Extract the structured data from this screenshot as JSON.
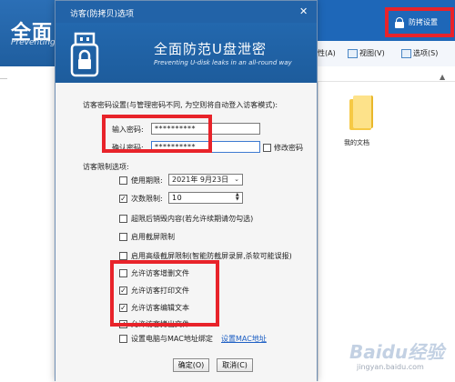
{
  "background_app": {
    "title": "全面",
    "subtitle": "Preventing",
    "protect_button": "防拷设置",
    "toolbar": [
      {
        "label": "性(A)"
      },
      {
        "label": "视图(V)"
      },
      {
        "label": "选项(S)"
      }
    ],
    "folder_label": "我的文档"
  },
  "dialog": {
    "title": "访客(防拷贝)选项",
    "close": "✕",
    "banner_title": "全面防范U盘泄密",
    "banner_subtitle": "Preventing U-disk leaks in an all-round way",
    "password_section_label": "访客密码设置(与管理密码不同, 为空则将自动登入访客模式):",
    "password_label": "输入密码:",
    "password_value": "**********",
    "confirm_label": "确认密码:",
    "confirm_value": "**********",
    "modify_password_label": "修改密码",
    "limits_label": "访客限制选项:",
    "expiry_label": "使用期限:",
    "expiry_date": "2021年  9月23日",
    "count_label": "次数限制:",
    "count_value": "10",
    "options": [
      {
        "label": "超限后销毁内容(若允许续期请勿勾选)",
        "checked": false
      },
      {
        "label": "启用截屏限制",
        "checked": false
      },
      {
        "label": "启用高级截屏限制(智能防截屏录屏,杀软可能误报)",
        "checked": false
      },
      {
        "label": "允许访客增删文件",
        "checked": false
      },
      {
        "label": "允许访客打印文件",
        "checked": true
      },
      {
        "label": "允许访客编辑文本",
        "checked": true
      },
      {
        "label": "允许访客拷出文件",
        "checked": true
      },
      {
        "label": "设置电脑与MAC地址绑定",
        "checked": false
      }
    ],
    "expiry_checked": false,
    "count_checked": true,
    "modify_checked": false,
    "mac_link": "设置MAC地址",
    "ok_button": "确定(O)",
    "cancel_button": "取消(C)"
  },
  "watermark": {
    "logo": "Baidu经验",
    "url": "jingyan.baidu.com"
  },
  "colors": {
    "accent": "#2263a8",
    "highlight": "#e8232a"
  }
}
